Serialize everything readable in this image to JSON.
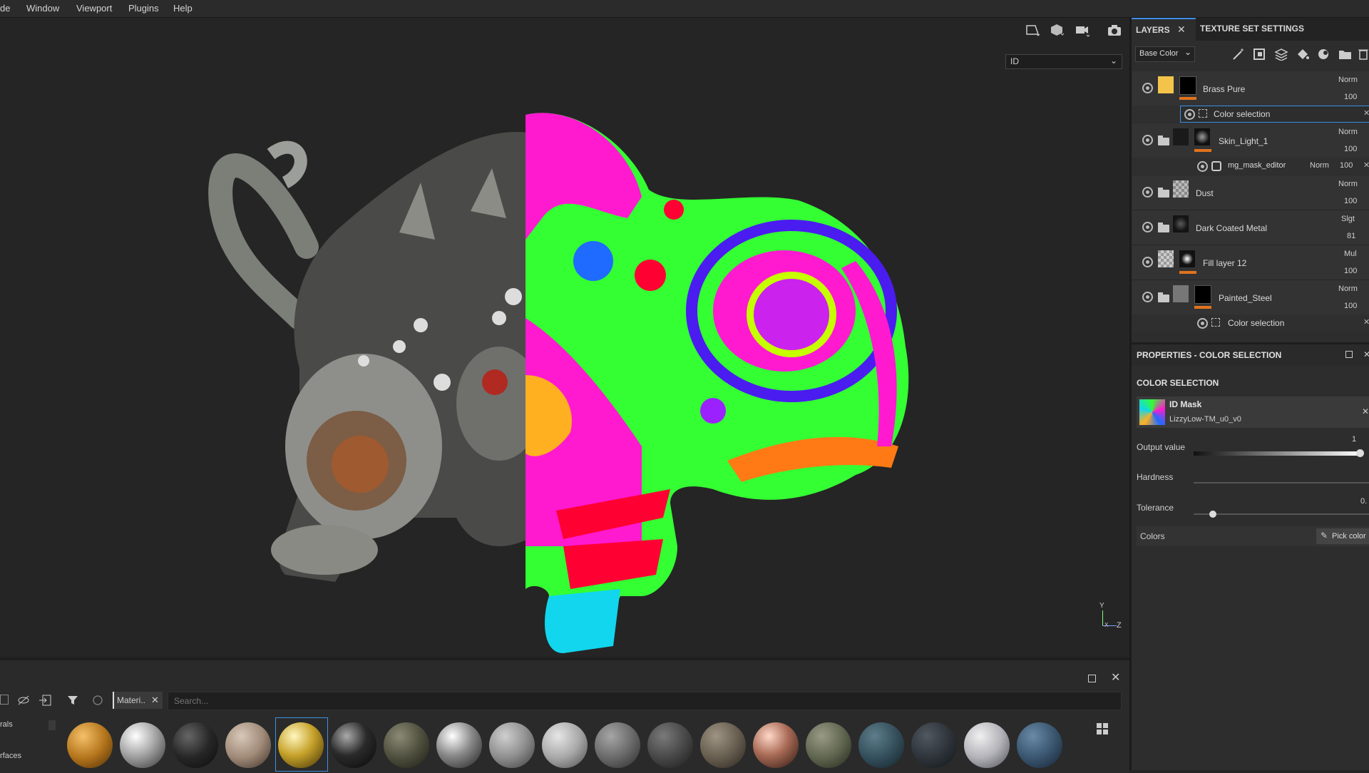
{
  "menu": [
    "de",
    "Window",
    "Viewport",
    "Plugins",
    "Help"
  ],
  "viewport": {
    "channel": "ID",
    "axis": {
      "y": "Y",
      "x": "X",
      "z": "Z"
    }
  },
  "layers_panel": {
    "tabs": [
      "LAYERS",
      "TEXTURE SET SETTINGS"
    ],
    "channel_dropdown": "Base Color",
    "layers": [
      {
        "name": "Brass Pure",
        "blend": "Norm",
        "opacity": "100"
      },
      {
        "name": "Skin_Light_1",
        "blend": "Norm",
        "opacity": "100"
      },
      {
        "name": "Dust",
        "blend": "Norm",
        "opacity": "100"
      },
      {
        "name": "Dark Coated Metal",
        "blend": "Slgt",
        "opacity": "81"
      },
      {
        "name": "Fill layer 12",
        "blend": "Mul",
        "opacity": "100"
      },
      {
        "name": "Painted_Steel",
        "blend": "Norm",
        "opacity": "100"
      }
    ],
    "sublayers": {
      "color_selection_1": "Color selection",
      "mask_editor": {
        "name": "mg_mask_editor",
        "blend": "Norm",
        "opacity": "100"
      },
      "color_selection_2": "Color selection"
    }
  },
  "properties": {
    "header": "PROPERTIES - COLOR SELECTION",
    "section": "COLOR SELECTION",
    "id_mask_title": "ID Mask",
    "id_mask_file": "LizzyLow-TM_u0_v0",
    "output_value_label": "Output value",
    "output_value": "1",
    "hardness_label": "Hardness",
    "tolerance_label": "Tolerance",
    "tolerance_value": "0.",
    "colors_label": "Colors",
    "pick_color": "Pick color"
  },
  "shelf": {
    "side_labels": [
      "rals",
      "rfaces"
    ],
    "filter_chip": "Materi..",
    "search_placeholder": "Search...",
    "materials_count_shown": 19
  }
}
